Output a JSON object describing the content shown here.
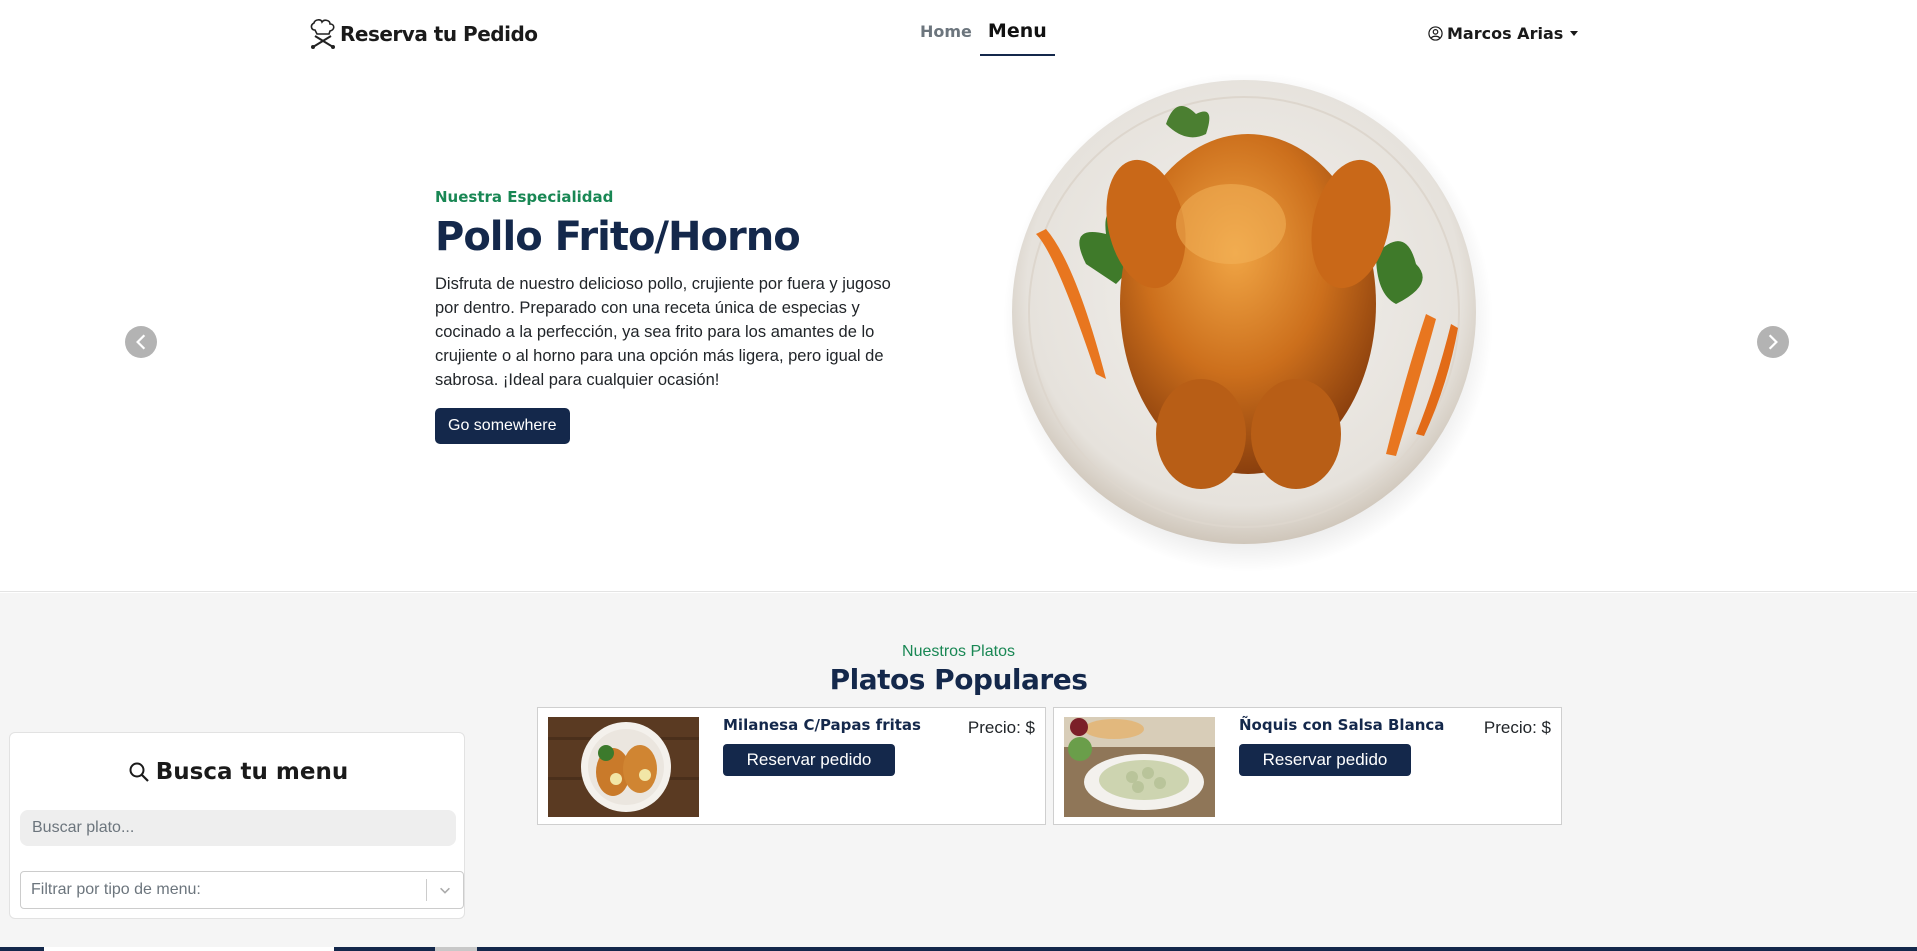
{
  "navbar": {
    "brand": "Reserva tu Pedido",
    "brand_icon": "chef-hat-icon",
    "links": [
      {
        "label": "Home",
        "active": false
      },
      {
        "label": "Menu",
        "active": true
      }
    ],
    "user": {
      "name": "Marcos Arias",
      "icon": "user-circle-icon"
    }
  },
  "hero": {
    "eyebrow": "Nuestra Especialidad",
    "title": "Pollo Frito/Horno",
    "description": "Disfruta de nuestro delicioso pollo, crujiente por fuera y jugoso por dentro. Preparado con una receta única de especias y cocinado a la perfección, ya sea frito para los amantes de lo crujiente o al horno para una opción más ligera, pero igual de sabrosa. ¡Ideal para cualquier ocasión!",
    "button": "Go somewhere"
  },
  "section": {
    "eyebrow": "Nuestros Platos",
    "title": "Platos Populares",
    "dishes": [
      {
        "name": "Milanesa C/Papas fritas",
        "price": "Precio: $",
        "button": "Reservar pedido"
      },
      {
        "name": "Ñoquis con Salsa Blanca",
        "price": "Precio: $",
        "button": "Reservar pedido"
      }
    ]
  },
  "search": {
    "title": "Busca tu menu",
    "input_placeholder": "Buscar plato...",
    "filter_placeholder": "Filtrar por tipo de menu:"
  },
  "colors": {
    "primary": "#14284b",
    "accent_green": "#198754",
    "section_bg": "#f5f5f5"
  }
}
